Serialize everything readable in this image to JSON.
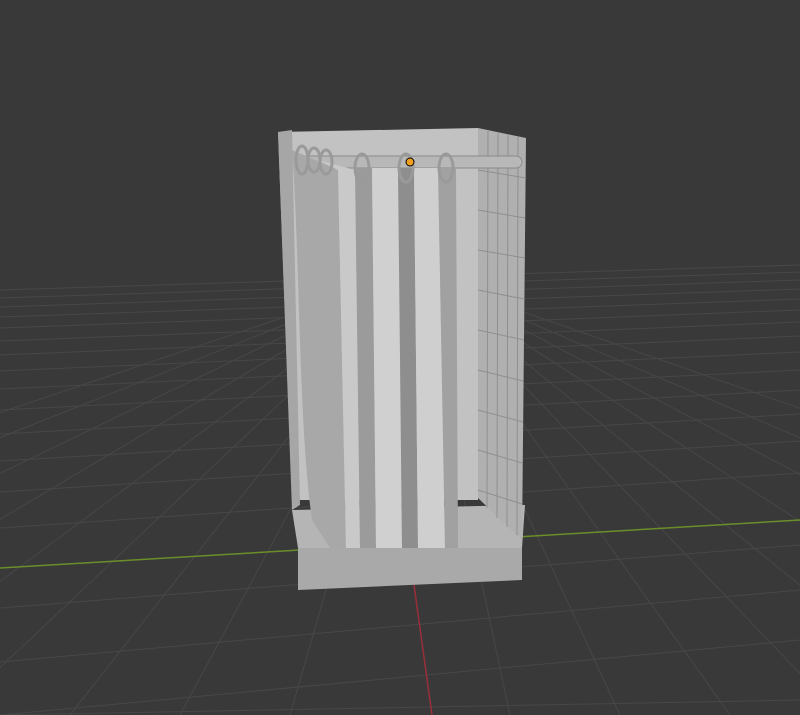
{
  "viewport": {
    "background": "#393939",
    "grid_color": "#444444",
    "x_axis_color": "#6a8f2a",
    "y_axis_color": "#9a2f3a"
  },
  "object": {
    "name": "shower-enclosure",
    "body_color": "#bcbcbc",
    "shade_color": "#9a9a9a",
    "dark_color": "#7d7d7d",
    "origin_color": "#f0a020"
  }
}
